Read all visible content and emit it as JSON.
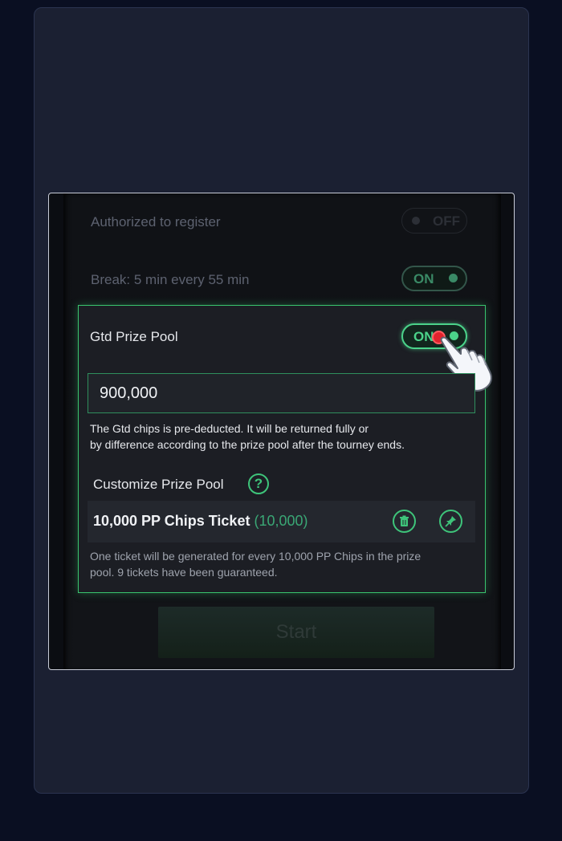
{
  "rows": {
    "authorized": {
      "label": "Authorized to register",
      "toggle": "OFF"
    },
    "break": {
      "label": "Break: 5 min every 55 min",
      "toggle": "ON"
    }
  },
  "gtd": {
    "title": "Gtd Prize Pool",
    "toggle": "ON",
    "amount": "900,000",
    "desc_line1": "The Gtd chips is pre-deducted. It will be returned fully or",
    "desc_line2": "by difference according to the prize pool after the tourney ends."
  },
  "customize": {
    "title": "Customize Prize Pool",
    "help": "?",
    "ticket_name": "10,000 PP Chips Ticket",
    "ticket_amount": "(10,000)",
    "note_line1": "One ticket will be generated for every 10,000 PP Chips in the prize",
    "note_line2": "pool. 9 tickets have been guaranteed."
  },
  "start_label": "Start",
  "colors": {
    "accent_green": "#3ec47a",
    "background": "#0a0f22",
    "panel": "#1c1e24",
    "tap_indicator": "#e0232d"
  },
  "icons": [
    "trash-icon",
    "edit-pin-icon",
    "help-icon",
    "pointing-hand-icon"
  ]
}
